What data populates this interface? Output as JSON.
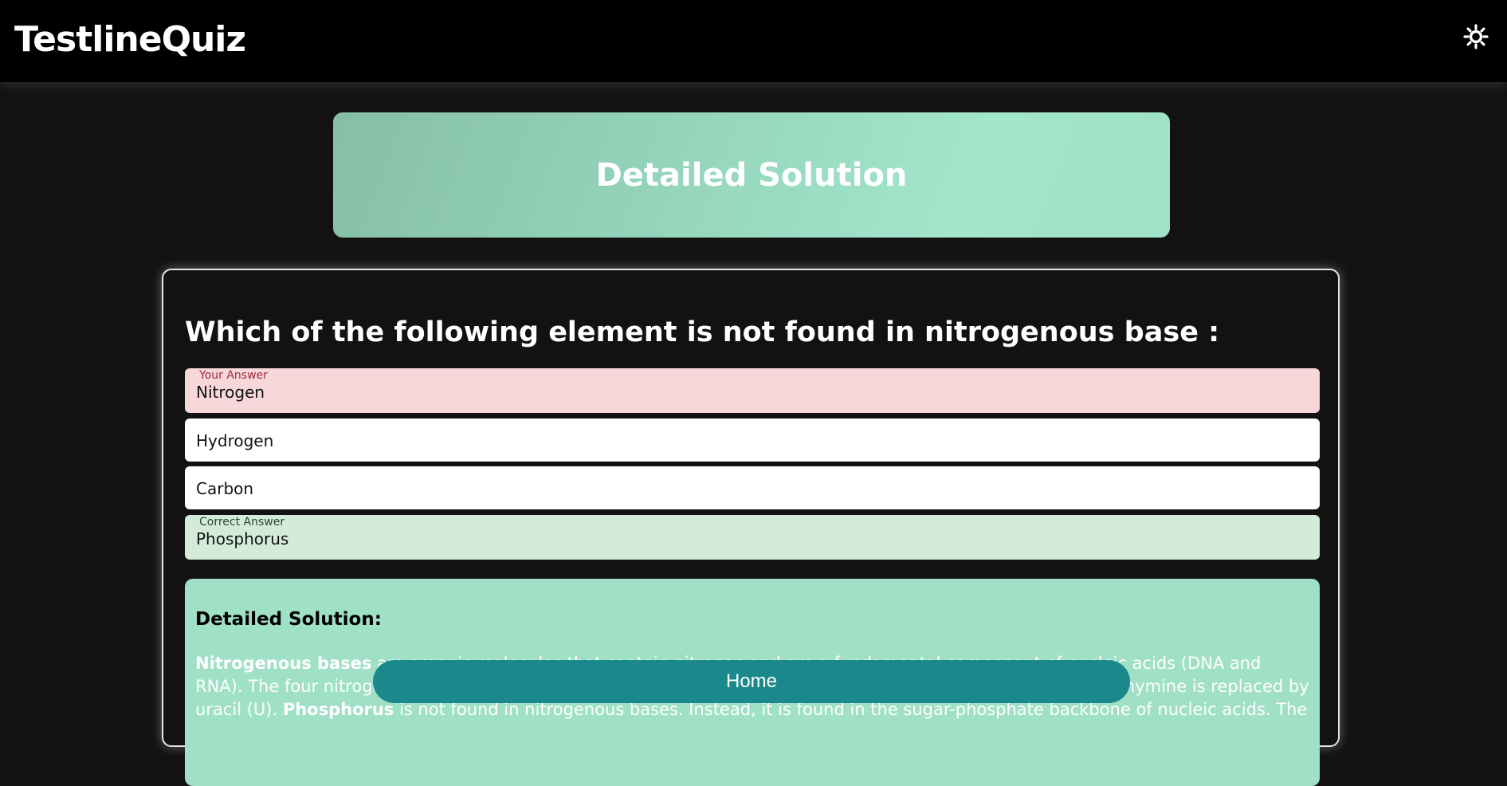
{
  "app": {
    "brand": "TestlineQuiz"
  },
  "header": {
    "title": "Detailed Solution"
  },
  "question": {
    "text": "Which of the following element is not found in nitrogenous base :",
    "options": [
      {
        "label": "Nitrogen",
        "tag": "Your Answer",
        "state": "wrong"
      },
      {
        "label": "Hydrogen",
        "tag": "",
        "state": "neutral"
      },
      {
        "label": "Carbon",
        "tag": "",
        "state": "neutral"
      },
      {
        "label": "Phosphorus",
        "tag": "Correct Answer",
        "state": "correct"
      }
    ]
  },
  "solution": {
    "title": "Detailed Solution:",
    "term1": "Nitrogenous bases",
    "text1": " are organic molecules that contain nitrogen and are a fundamental component of nucleic acids (DNA and RNA). The four nitrogenous bases in DNA are adenine (A), guanine (G), cytosine (C), and thymine (T). In RNA, thymine is replaced by uracil (U). ",
    "term2": "Phosphorus",
    "text2": " is not found in nitrogenous bases. Instead, it is found in the sugar-phosphate backbone of nucleic acids. The"
  },
  "footer": {
    "home_label": "Home"
  },
  "colors": {
    "navbar_bg": "#000000",
    "page_bg": "#121212",
    "wrong_bg": "#f8d7da",
    "correct_bg": "#d4ebda",
    "solution_bg": "#9fe0c6",
    "home_button_bg": "#1b898c"
  },
  "icons": {
    "theme_toggle": "sun-icon"
  }
}
